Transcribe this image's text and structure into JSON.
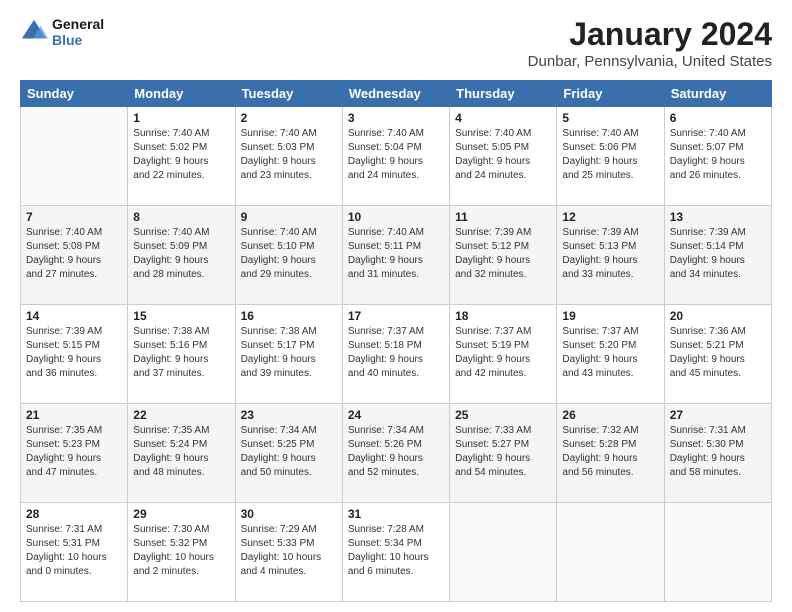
{
  "logo": {
    "line1": "General",
    "line2": "Blue"
  },
  "title": "January 2024",
  "subtitle": "Dunbar, Pennsylvania, United States",
  "days_of_week": [
    "Sunday",
    "Monday",
    "Tuesday",
    "Wednesday",
    "Thursday",
    "Friday",
    "Saturday"
  ],
  "weeks": [
    [
      {
        "day": "",
        "info": ""
      },
      {
        "day": "1",
        "info": "Sunrise: 7:40 AM\nSunset: 5:02 PM\nDaylight: 9 hours\nand 22 minutes."
      },
      {
        "day": "2",
        "info": "Sunrise: 7:40 AM\nSunset: 5:03 PM\nDaylight: 9 hours\nand 23 minutes."
      },
      {
        "day": "3",
        "info": "Sunrise: 7:40 AM\nSunset: 5:04 PM\nDaylight: 9 hours\nand 24 minutes."
      },
      {
        "day": "4",
        "info": "Sunrise: 7:40 AM\nSunset: 5:05 PM\nDaylight: 9 hours\nand 24 minutes."
      },
      {
        "day": "5",
        "info": "Sunrise: 7:40 AM\nSunset: 5:06 PM\nDaylight: 9 hours\nand 25 minutes."
      },
      {
        "day": "6",
        "info": "Sunrise: 7:40 AM\nSunset: 5:07 PM\nDaylight: 9 hours\nand 26 minutes."
      }
    ],
    [
      {
        "day": "7",
        "info": "Sunrise: 7:40 AM\nSunset: 5:08 PM\nDaylight: 9 hours\nand 27 minutes."
      },
      {
        "day": "8",
        "info": "Sunrise: 7:40 AM\nSunset: 5:09 PM\nDaylight: 9 hours\nand 28 minutes."
      },
      {
        "day": "9",
        "info": "Sunrise: 7:40 AM\nSunset: 5:10 PM\nDaylight: 9 hours\nand 29 minutes."
      },
      {
        "day": "10",
        "info": "Sunrise: 7:40 AM\nSunset: 5:11 PM\nDaylight: 9 hours\nand 31 minutes."
      },
      {
        "day": "11",
        "info": "Sunrise: 7:39 AM\nSunset: 5:12 PM\nDaylight: 9 hours\nand 32 minutes."
      },
      {
        "day": "12",
        "info": "Sunrise: 7:39 AM\nSunset: 5:13 PM\nDaylight: 9 hours\nand 33 minutes."
      },
      {
        "day": "13",
        "info": "Sunrise: 7:39 AM\nSunset: 5:14 PM\nDaylight: 9 hours\nand 34 minutes."
      }
    ],
    [
      {
        "day": "14",
        "info": "Sunrise: 7:39 AM\nSunset: 5:15 PM\nDaylight: 9 hours\nand 36 minutes."
      },
      {
        "day": "15",
        "info": "Sunrise: 7:38 AM\nSunset: 5:16 PM\nDaylight: 9 hours\nand 37 minutes."
      },
      {
        "day": "16",
        "info": "Sunrise: 7:38 AM\nSunset: 5:17 PM\nDaylight: 9 hours\nand 39 minutes."
      },
      {
        "day": "17",
        "info": "Sunrise: 7:37 AM\nSunset: 5:18 PM\nDaylight: 9 hours\nand 40 minutes."
      },
      {
        "day": "18",
        "info": "Sunrise: 7:37 AM\nSunset: 5:19 PM\nDaylight: 9 hours\nand 42 minutes."
      },
      {
        "day": "19",
        "info": "Sunrise: 7:37 AM\nSunset: 5:20 PM\nDaylight: 9 hours\nand 43 minutes."
      },
      {
        "day": "20",
        "info": "Sunrise: 7:36 AM\nSunset: 5:21 PM\nDaylight: 9 hours\nand 45 minutes."
      }
    ],
    [
      {
        "day": "21",
        "info": "Sunrise: 7:35 AM\nSunset: 5:23 PM\nDaylight: 9 hours\nand 47 minutes."
      },
      {
        "day": "22",
        "info": "Sunrise: 7:35 AM\nSunset: 5:24 PM\nDaylight: 9 hours\nand 48 minutes."
      },
      {
        "day": "23",
        "info": "Sunrise: 7:34 AM\nSunset: 5:25 PM\nDaylight: 9 hours\nand 50 minutes."
      },
      {
        "day": "24",
        "info": "Sunrise: 7:34 AM\nSunset: 5:26 PM\nDaylight: 9 hours\nand 52 minutes."
      },
      {
        "day": "25",
        "info": "Sunrise: 7:33 AM\nSunset: 5:27 PM\nDaylight: 9 hours\nand 54 minutes."
      },
      {
        "day": "26",
        "info": "Sunrise: 7:32 AM\nSunset: 5:28 PM\nDaylight: 9 hours\nand 56 minutes."
      },
      {
        "day": "27",
        "info": "Sunrise: 7:31 AM\nSunset: 5:30 PM\nDaylight: 9 hours\nand 58 minutes."
      }
    ],
    [
      {
        "day": "28",
        "info": "Sunrise: 7:31 AM\nSunset: 5:31 PM\nDaylight: 10 hours\nand 0 minutes."
      },
      {
        "day": "29",
        "info": "Sunrise: 7:30 AM\nSunset: 5:32 PM\nDaylight: 10 hours\nand 2 minutes."
      },
      {
        "day": "30",
        "info": "Sunrise: 7:29 AM\nSunset: 5:33 PM\nDaylight: 10 hours\nand 4 minutes."
      },
      {
        "day": "31",
        "info": "Sunrise: 7:28 AM\nSunset: 5:34 PM\nDaylight: 10 hours\nand 6 minutes."
      },
      {
        "day": "",
        "info": ""
      },
      {
        "day": "",
        "info": ""
      },
      {
        "day": "",
        "info": ""
      }
    ]
  ]
}
